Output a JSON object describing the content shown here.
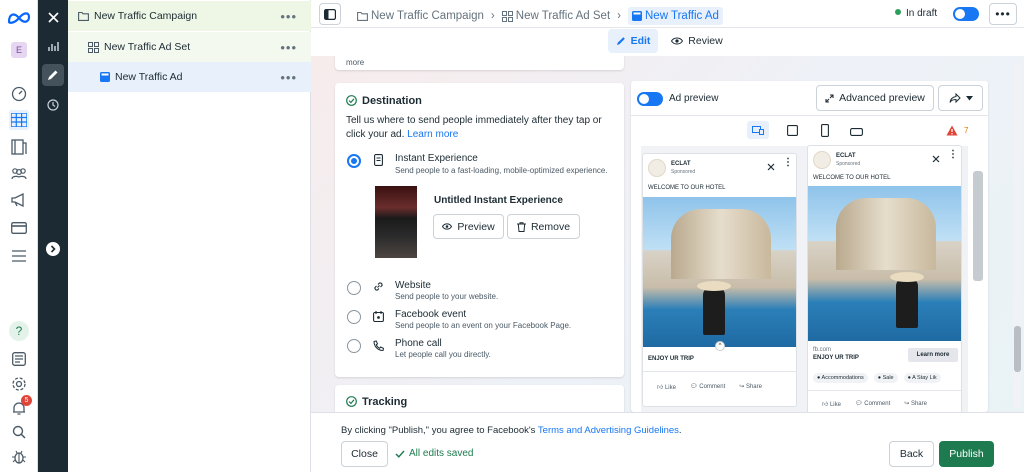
{
  "rail": {
    "icons": [
      "meta-logo",
      "account-e-badge",
      "chart-icon",
      "edit-icon",
      "clock-icon",
      "dashboard-icon",
      "campaigns-icon",
      "pages-icon",
      "audiences-icon",
      "megaphone-icon",
      "billing-icon",
      "menu-icon",
      "help-icon",
      "news-icon",
      "settings-icon",
      "notifications-icon",
      "search-icon",
      "bug-icon"
    ],
    "account_letter": "E",
    "notification_count": "5",
    "help_symbol": "?"
  },
  "tree": {
    "campaign": "New Traffic Campaign",
    "adset": "New Traffic Ad Set",
    "ad": "New Traffic Ad"
  },
  "breadcrumb": {
    "campaign": "New Traffic Campaign",
    "adset": "New Traffic Ad Set",
    "ad": "New Traffic Ad",
    "status": "In draft"
  },
  "tabs": {
    "edit": "Edit",
    "review": "Review"
  },
  "top_more_text": "more",
  "destination": {
    "title": "Destination",
    "description": "Tell us where to send people immediately after they tap or click your ad.",
    "learn_more": "Learn more",
    "options": [
      {
        "title": "Instant Experience",
        "sub": "Send people to a fast-loading, mobile-optimized experience.",
        "selected": true
      },
      {
        "title": "Website",
        "sub": "Send people to your website.",
        "selected": false
      },
      {
        "title": "Facebook event",
        "sub": "Send people to an event on your Facebook Page.",
        "selected": false
      },
      {
        "title": "Phone call",
        "sub": "Let people call you directly.",
        "selected": false
      }
    ],
    "instant_name": "Untitled Instant Experience",
    "preview_btn": "Preview",
    "remove_btn": "Remove"
  },
  "tracking": {
    "title": "Tracking"
  },
  "preview": {
    "label": "Ad preview",
    "advanced": "Advanced preview",
    "warning_count": "7",
    "left_ad": {
      "brand": "ECLAT",
      "sponsored": "Sponsored",
      "text": "WELCOME TO OUR HOTEL",
      "headline": "ENJOY UR TRIP",
      "actions": [
        "Like",
        "Comment",
        "Share"
      ]
    },
    "right_ad": {
      "brand": "ECLAT",
      "sponsored": "Sponsored",
      "text": "WELCOME TO OUR HOTEL",
      "domain": "fb.com",
      "headline": "ENJOY UR TRIP",
      "cta": "Learn more",
      "chips": [
        "Accommodations",
        "Sale",
        "A Stay Lik"
      ],
      "actions": [
        "Like",
        "Comment",
        "Share"
      ]
    }
  },
  "footer": {
    "agree_prefix": "By clicking \"Publish,\" you agree to Facebook's",
    "agree_link": "Terms and Advertising Guidelines",
    "agree_suffix": ".",
    "close": "Close",
    "saved": "All edits saved",
    "back": "Back",
    "publish": "Publish"
  },
  "colors": {
    "accent": "#1877f2",
    "publish": "#1e7b4f",
    "dark_panel": "#1c2b33",
    "selected_row": "#e7f0fb",
    "campaign_row": "#eef6e6"
  }
}
